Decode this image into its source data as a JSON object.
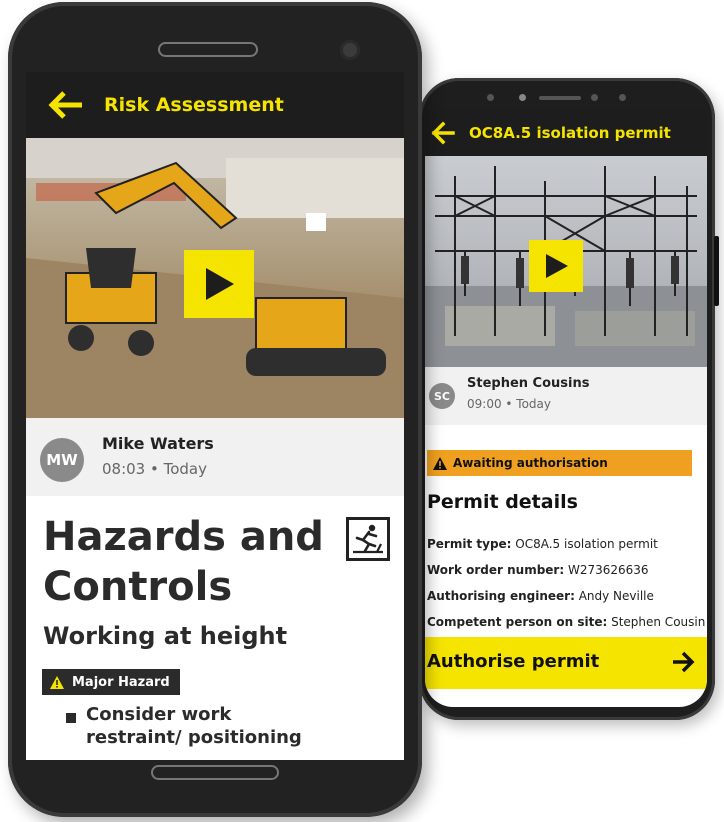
{
  "colors": {
    "accent": "#f5e400",
    "header": "#1d1d1d",
    "status_amber": "#f0a020"
  },
  "front_phone": {
    "header": {
      "back_icon": "arrow-left-icon",
      "title": "Risk Assessment"
    },
    "media": {
      "play_icon": "play-icon"
    },
    "author": {
      "initials": "MW",
      "name": "Mike Waters",
      "time": "08:03 • Today"
    },
    "content": {
      "heading": "Hazards and Controls",
      "hazard_icon": "fall-hazard-icon",
      "subheading": "Working at height",
      "badge": {
        "icon": "warning-icon",
        "label": "Major Hazard"
      },
      "controls": [
        "Consider work restraint/ positioning"
      ]
    }
  },
  "back_phone": {
    "header": {
      "back_icon": "arrow-left-icon",
      "title": "OC8A.5 isolation permit"
    },
    "media": {
      "play_icon": "play-icon"
    },
    "author": {
      "initials": "SC",
      "name": "Stephen Cousins",
      "time": "09:00 • Today"
    },
    "status": {
      "icon": "warning-icon",
      "label": "Awaiting authorisation"
    },
    "details_title": "Permit details",
    "details": [
      {
        "label": "Permit type:",
        "value": " OC8A.5 isolation permit"
      },
      {
        "label": "Work order number:",
        "value": " W273626636"
      },
      {
        "label": "Authorising engineer:",
        "value": " Andy Neville"
      },
      {
        "label": "Competent person on site:",
        "value": " Stephen Cousin"
      }
    ],
    "action": {
      "label": "Authorise permit",
      "icon": "arrow-right-icon"
    }
  }
}
